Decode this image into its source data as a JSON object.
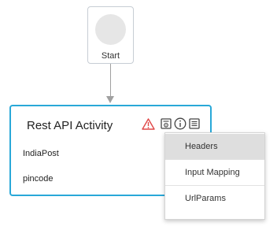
{
  "start_node": {
    "label": "Start"
  },
  "activity": {
    "title": "Rest API Activity",
    "fields": [
      "IndiaPost",
      "pincode"
    ],
    "icons": [
      "warning-icon",
      "document-settings-icon",
      "info-icon",
      "list-icon"
    ]
  },
  "context_menu": {
    "items": [
      {
        "label": "Headers",
        "active": true
      },
      {
        "label": "Input Mapping",
        "active": false
      },
      {
        "label": "UrlParams",
        "active": false
      }
    ]
  },
  "colors": {
    "accent_border": "#29a8d8",
    "warning": "#e04848",
    "connector": "#a0a0a0",
    "menu_highlight": "#dedede"
  }
}
